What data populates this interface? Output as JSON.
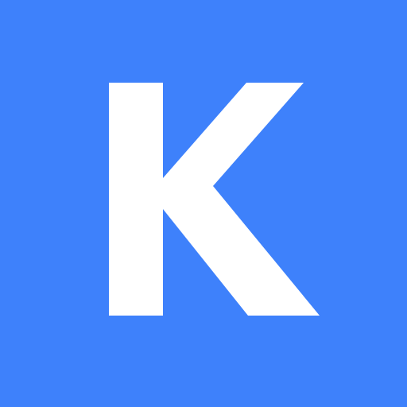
{
  "logo": {
    "letter": "K",
    "background_color": "#3E81FB",
    "letter_color": "#FFFFFF"
  }
}
